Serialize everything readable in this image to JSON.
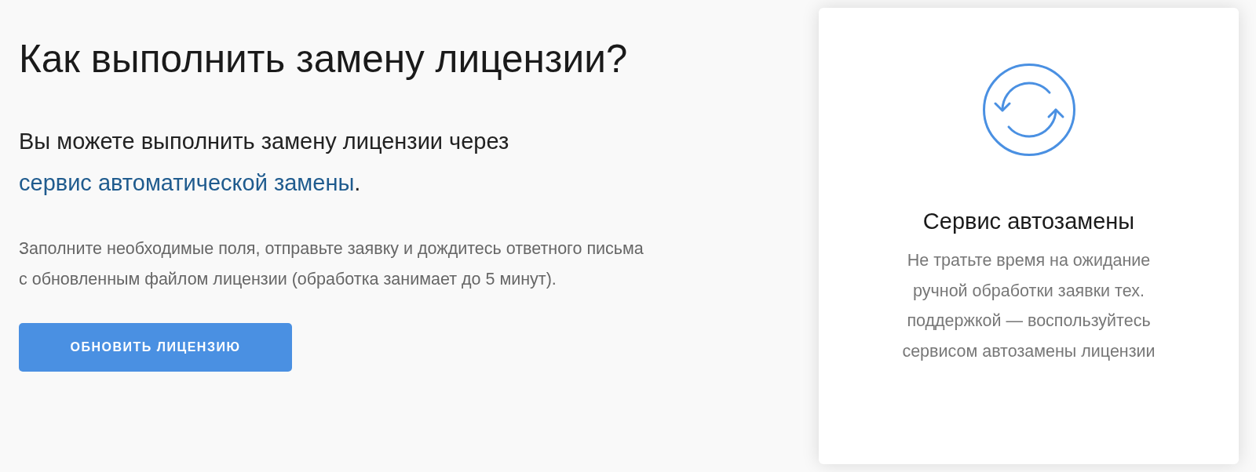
{
  "heading": "Как выполнить замену лицензии?",
  "intro": {
    "text": "Вы можете выполнить замену лицензии через ",
    "link": "сервис автоматической замены",
    "after": "."
  },
  "note": "Заполните необходимые поля, отправьте заявку и дождитесь ответного письма с обновленным файлом лицензии (обработка занимает до 5 минут).",
  "button": {
    "label": "ОБНОВИТЬ ЛИЦЕНЗИЮ"
  },
  "service_card": {
    "title": "Сервис автозамены",
    "description": "Не тратьте время на ожидание ручной обработки заявки тех. поддержкой — воспользуйтесь сервисом автозамены лицензии"
  }
}
